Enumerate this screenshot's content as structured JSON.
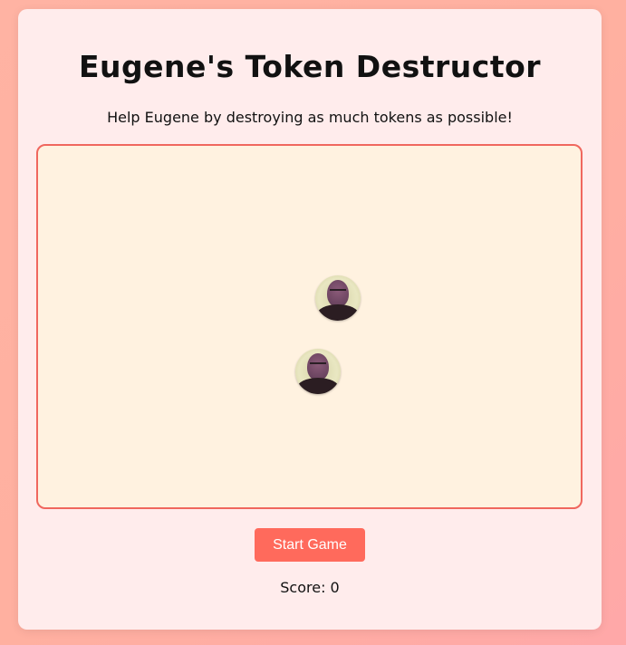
{
  "game": {
    "title": "Eugene's Token Destructor",
    "subtitle": "Help Eugene by destroying as much tokens as possible!",
    "start_button_label": "Start Game",
    "score_text": "Score: 0",
    "score": 0,
    "tokens": [
      {
        "icon": "eugene-face-token-icon"
      },
      {
        "icon": "eugene-face-token-icon"
      }
    ]
  },
  "colors": {
    "page_background": "#ffb0a0",
    "card_background": "#ffecec",
    "game_area_background": "#fff2e0",
    "game_area_border": "#f0675e",
    "button_background": "#ff6a5c",
    "button_text": "#ffffff"
  }
}
